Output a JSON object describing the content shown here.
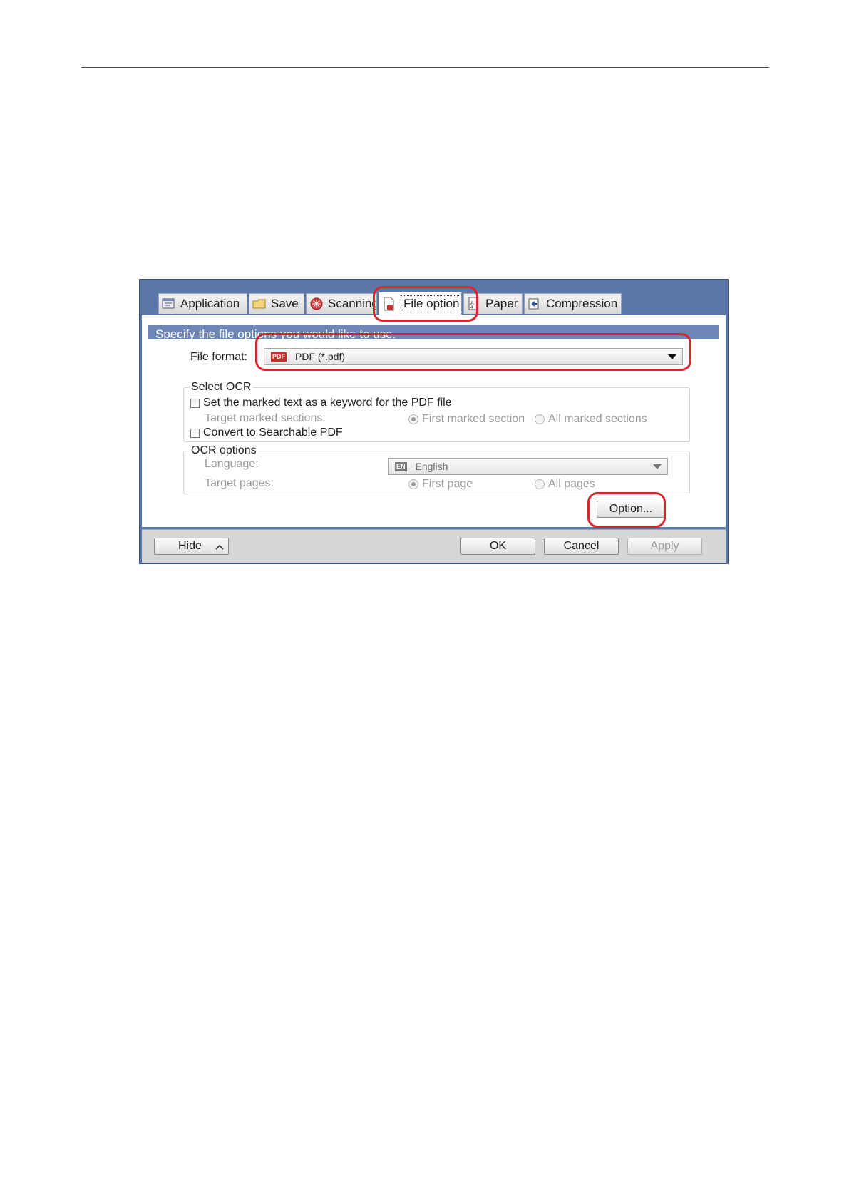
{
  "dialog": {
    "tabs": [
      {
        "label": "Application",
        "icon": "application-icon"
      },
      {
        "label": "Save",
        "icon": "folder-icon"
      },
      {
        "label": "Scanning",
        "icon": "scanning-icon"
      },
      {
        "label": "File option",
        "icon": "file-pdf-icon",
        "active": true
      },
      {
        "label": "Paper",
        "icon": "paper-icon"
      },
      {
        "label": "Compression",
        "icon": "compression-icon"
      }
    ],
    "header_text": "Specify the file options you would like to use.",
    "file_format": {
      "label": "File format:",
      "value": "PDF (*.pdf)",
      "badge": "PDF"
    },
    "select_ocr": {
      "title": "Select OCR",
      "keyword_checkbox": {
        "label": "Set the marked text as a keyword for the PDF file",
        "checked": false
      },
      "target_label": "Target marked sections:",
      "radio_first": {
        "label": "First marked section",
        "selected": true
      },
      "radio_all": {
        "label": "All marked sections",
        "selected": false
      },
      "searchable_checkbox": {
        "label": "Convert to Searchable PDF",
        "checked": false
      }
    },
    "ocr_options": {
      "title": "OCR options",
      "language_label": "Language:",
      "language_badge": "EN",
      "language_value": "English",
      "target_pages_label": "Target pages:",
      "radio_first": {
        "label": "First page",
        "selected": true
      },
      "radio_all": {
        "label": "All pages",
        "selected": false
      }
    },
    "option_button": "Option...",
    "footer": {
      "hide": "Hide",
      "ok": "OK",
      "cancel": "Cancel",
      "apply": "Apply"
    }
  },
  "colors": {
    "window_frame": "#5b77a8",
    "header_strip": "#6d86b6",
    "callout": "#d9262c"
  }
}
